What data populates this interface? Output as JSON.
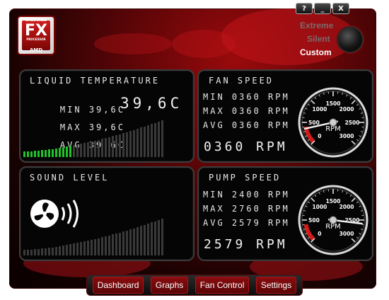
{
  "window_controls": {
    "help": "?",
    "minimize": "_",
    "close": "X"
  },
  "logo": {
    "top_text": "UNLOCKED",
    "brand": "FX",
    "sub_text": "PROCESSOR",
    "maker": "AMD"
  },
  "modes": {
    "extreme": "Extreme",
    "silent": "Silent",
    "custom": "Custom",
    "selected": "Custom"
  },
  "liquid": {
    "title": "LIQUID TEMPERATURE",
    "min_label": "MIN",
    "min_value": "39,6C",
    "max_label": "MAX",
    "max_value": "39,6C",
    "avg_label": "AVG",
    "avg_value": "39,6C",
    "current": "39,6C",
    "bar_count": 40,
    "lit_bars": 14
  },
  "fan": {
    "title": "FAN SPEED",
    "min_label": "MIN",
    "min_value": "0360 RPM",
    "max_label": "MAX",
    "max_value": "0360 RPM",
    "avg_label": "AVG",
    "avg_value": "0360 RPM",
    "current": "0360 RPM",
    "gauge_value": 360,
    "gauge_unit": "RPM",
    "gauge_ticks": [
      "0",
      "500",
      "1000",
      "1500",
      "2000",
      "2500",
      "3000"
    ]
  },
  "sound": {
    "title": "SOUND LEVEL",
    "bar_count": 40,
    "lit_bars": 0
  },
  "pump": {
    "title": "PUMP SPEED",
    "min_label": "MIN",
    "min_value": "2400 RPM",
    "max_label": "MAX",
    "max_value": "2760 RPM",
    "avg_label": "AVG",
    "avg_value": "2579 RPM",
    "current": "2579 RPM",
    "gauge_value": 2579,
    "gauge_unit": "RPM",
    "gauge_ticks": [
      "0",
      "500",
      "1000",
      "1500",
      "2000",
      "2500",
      "3000"
    ]
  },
  "nav": {
    "tabs": [
      "Dashboard",
      "Graphs",
      "Fan Control",
      "Settings"
    ]
  },
  "colors": {
    "accent": "#c3141a",
    "bar_on": "#21c22a",
    "bar_off": "#3a3a3a"
  }
}
